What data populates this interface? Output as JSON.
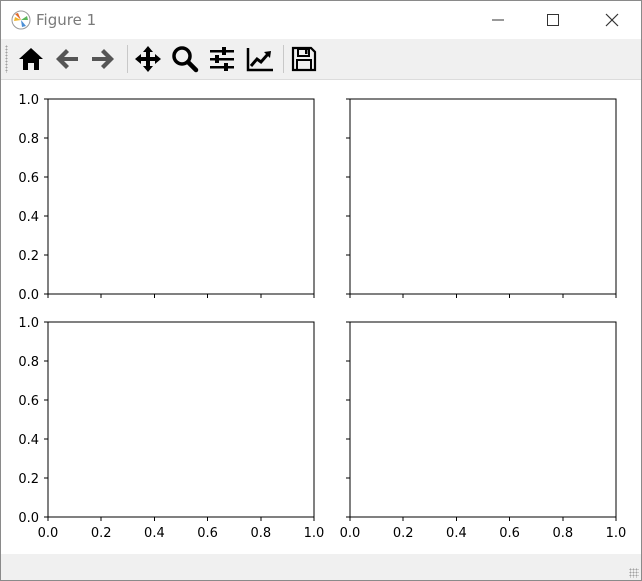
{
  "window": {
    "title": "Figure 1",
    "minimize_icon": "minimize-icon",
    "maximize_icon": "maximize-icon",
    "close_icon": "close-icon"
  },
  "toolbar": {
    "buttons": [
      {
        "name": "home",
        "icon": "home-icon"
      },
      {
        "name": "back",
        "icon": "arrow-left-icon"
      },
      {
        "name": "forward",
        "icon": "arrow-right-icon"
      },
      {
        "name": "pan",
        "icon": "move-icon"
      },
      {
        "name": "zoom",
        "icon": "magnifier-icon"
      },
      {
        "name": "configure-subplots",
        "icon": "sliders-icon"
      },
      {
        "name": "edit-axis",
        "icon": "line-chart-icon"
      },
      {
        "name": "save",
        "icon": "floppy-disk-icon"
      }
    ]
  },
  "chart_data": [
    {
      "type": "line",
      "series": [],
      "title": "",
      "xlabel": "",
      "ylabel": "",
      "xlim": [
        0,
        1
      ],
      "ylim": [
        0,
        1
      ],
      "grid": false,
      "xticks": [],
      "yticks": [
        "0.0",
        "0.2",
        "0.4",
        "0.6",
        "0.8",
        "1.0"
      ]
    },
    {
      "type": "line",
      "series": [],
      "title": "",
      "xlabel": "",
      "ylabel": "",
      "xlim": [
        0,
        1
      ],
      "ylim": [
        0,
        1
      ],
      "grid": false,
      "xticks": [],
      "yticks": []
    },
    {
      "type": "line",
      "series": [],
      "title": "",
      "xlabel": "",
      "ylabel": "",
      "xlim": [
        0,
        1
      ],
      "ylim": [
        0,
        1
      ],
      "grid": false,
      "xticks": [
        "0.0",
        "0.2",
        "0.4",
        "0.6",
        "0.8",
        "1.0"
      ],
      "yticks": [
        "0.0",
        "0.2",
        "0.4",
        "0.6",
        "0.8",
        "1.0"
      ]
    },
    {
      "type": "line",
      "series": [],
      "title": "",
      "xlabel": "",
      "ylabel": "",
      "xlim": [
        0,
        1
      ],
      "ylim": [
        0,
        1
      ],
      "grid": false,
      "xticks": [
        "0.0",
        "0.2",
        "0.4",
        "0.6",
        "0.8",
        "1.0"
      ],
      "yticks": []
    }
  ]
}
